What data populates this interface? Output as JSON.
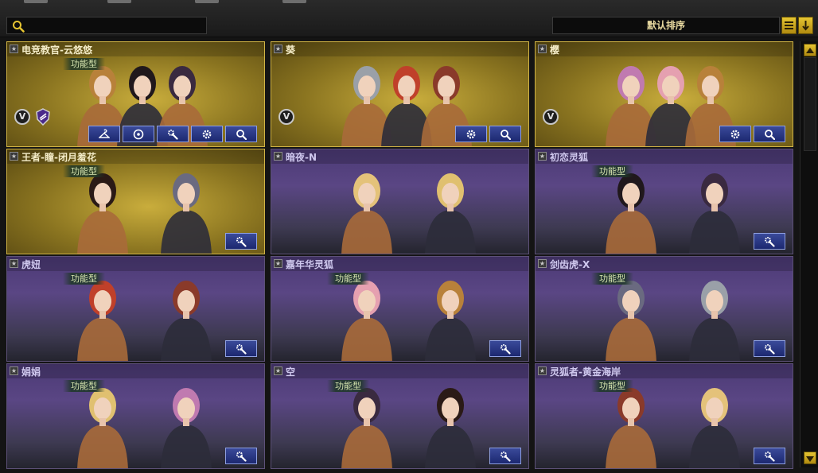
{
  "sort": {
    "label": "默认排序"
  },
  "colors": {
    "accent_gold": "#d1b445",
    "purple_card": "#5a4684",
    "button_blue": "#2b3a8a"
  },
  "cards": [
    {
      "name": "电竞教官-云悠悠",
      "tag": "功能型",
      "style": "gold",
      "rank_icon": "star-icon",
      "badges": [
        "v-badge-icon",
        "shield-badge-icon"
      ],
      "buttons": [
        "hanger-icon",
        "disc-icon",
        "gear-wrench-icon",
        "gear-icon",
        "search-icon"
      ]
    },
    {
      "name": "葵",
      "tag": "",
      "style": "gold",
      "rank_icon": "star-icon",
      "badges": [
        "v-badge-icon"
      ],
      "buttons": [
        "gear-icon",
        "search-icon"
      ]
    },
    {
      "name": "樱",
      "tag": "",
      "style": "gold",
      "rank_icon": "star-icon",
      "badges": [
        "v-badge-icon"
      ],
      "buttons": [
        "gear-icon",
        "search-icon"
      ]
    },
    {
      "name": "王者-瞳-闭月羞花",
      "tag": "功能型",
      "style": "gold",
      "rank_icon": "star-icon",
      "badges": [],
      "buttons": [
        "gear-wrench-icon"
      ]
    },
    {
      "name": "暗夜-N",
      "tag": "",
      "style": "purple",
      "rank_icon": "star-icon",
      "badges": [],
      "buttons": []
    },
    {
      "name": "初恋灵狐",
      "tag": "功能型",
      "style": "purple",
      "rank_icon": "star-icon",
      "badges": [],
      "buttons": [
        "gear-wrench-icon"
      ]
    },
    {
      "name": "虎妞",
      "tag": "功能型",
      "style": "purple",
      "rank_icon": "star-icon",
      "badges": [],
      "buttons": [
        "gear-wrench-icon"
      ]
    },
    {
      "name": "嘉年华灵狐",
      "tag": "功能型",
      "style": "purple",
      "rank_icon": "star-icon",
      "badges": [],
      "buttons": [
        "gear-wrench-icon"
      ]
    },
    {
      "name": "剑齿虎-X",
      "tag": "功能型",
      "style": "purple",
      "rank_icon": "star-icon",
      "badges": [],
      "buttons": [
        "gear-wrench-icon"
      ]
    },
    {
      "name": "娟娟",
      "tag": "功能型",
      "style": "purple",
      "rank_icon": "star-icon",
      "badges": [],
      "buttons": [
        "gear-wrench-icon"
      ]
    },
    {
      "name": "空",
      "tag": "功能型",
      "style": "purple",
      "rank_icon": "star-icon",
      "badges": [],
      "buttons": [
        "gear-wrench-icon"
      ]
    },
    {
      "name": "灵狐者-黄金海岸",
      "tag": "功能型",
      "style": "purple",
      "rank_icon": "star-icon",
      "badges": [],
      "buttons": [
        "gear-wrench-icon"
      ]
    }
  ]
}
